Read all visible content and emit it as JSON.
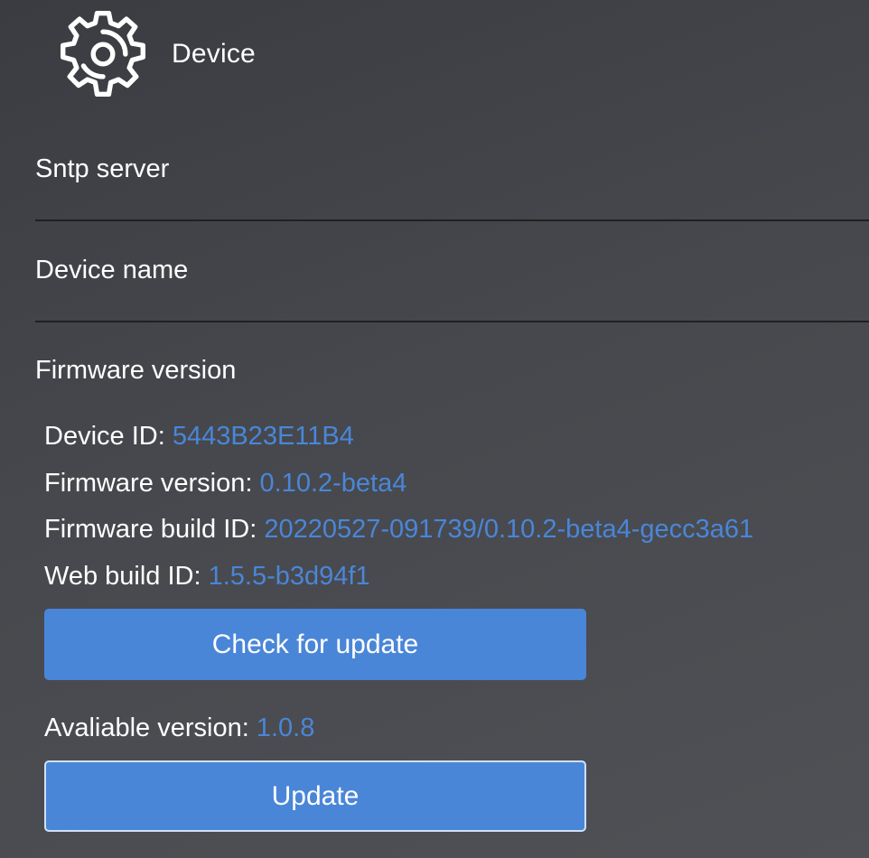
{
  "header": {
    "title": "Device",
    "icon": "gear-icon"
  },
  "fields": {
    "sntp_server": {
      "label": "Sntp server",
      "value": ""
    },
    "device_name": {
      "label": "Device name",
      "value": ""
    }
  },
  "firmware": {
    "section_title": "Firmware version",
    "device_id_label": "Device ID: ",
    "device_id": "5443B23E11B4",
    "firmware_version_label": "Firmware version: ",
    "firmware_version": "0.10.2-beta4",
    "firmware_build_label": "Firmware build ID: ",
    "firmware_build_id": "20220527-091739/0.10.2-beta4-gecc3a61",
    "web_build_label": "Web build ID: ",
    "web_build_id": "1.5.5-b3d94f1",
    "check_update_label": "Check for update",
    "available_label": "Avaliable version: ",
    "available_version": "1.0.8",
    "update_label": "Update"
  },
  "colors": {
    "accent": "#4a86d8",
    "background": "#46484d",
    "divider": "#1f2023"
  }
}
